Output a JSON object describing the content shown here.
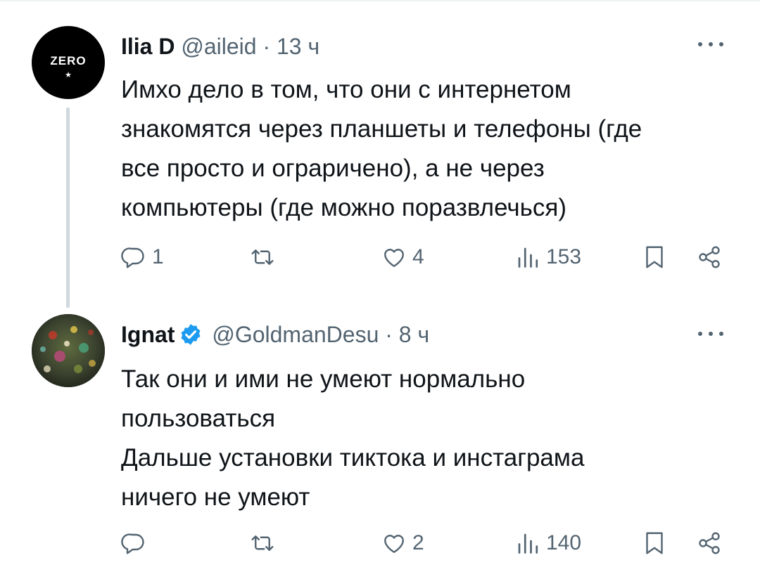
{
  "tweets": [
    {
      "avatar_text": "ZERO",
      "avatar_star": "★",
      "name": "Ilia D",
      "handle": "@aileid",
      "separator": "·",
      "time": "13 ч",
      "lines": [
        "Имхо дело в том, что они с интернетом",
        "знакомятся через планшеты и телефоны (где",
        "все просто и ограричено), а не через",
        "компьютеры (где можно поразвлечься)"
      ],
      "replies": "1",
      "retweets": "",
      "likes": "4",
      "views": "153"
    },
    {
      "name": "Ignat",
      "verified": true,
      "handle": "@GoldmanDesu",
      "separator": "·",
      "time": "8 ч",
      "lines": [
        "Так они и ими не умеют нормально",
        "пользоваться",
        "Дальше установки тиктока и инстаграма",
        "ничего не умеют"
      ],
      "replies": "",
      "retweets": "",
      "likes": "2",
      "views": "140"
    }
  ],
  "colors": {
    "text": "#0f1419",
    "muted": "#536471",
    "verified": "#1d9bf0",
    "thread_line": "#cfd9de"
  },
  "icons": [
    "reply-icon",
    "retweet-icon",
    "like-icon",
    "views-icon",
    "bookmark-icon",
    "share-icon",
    "more-icon",
    "verified-badge-icon"
  ]
}
